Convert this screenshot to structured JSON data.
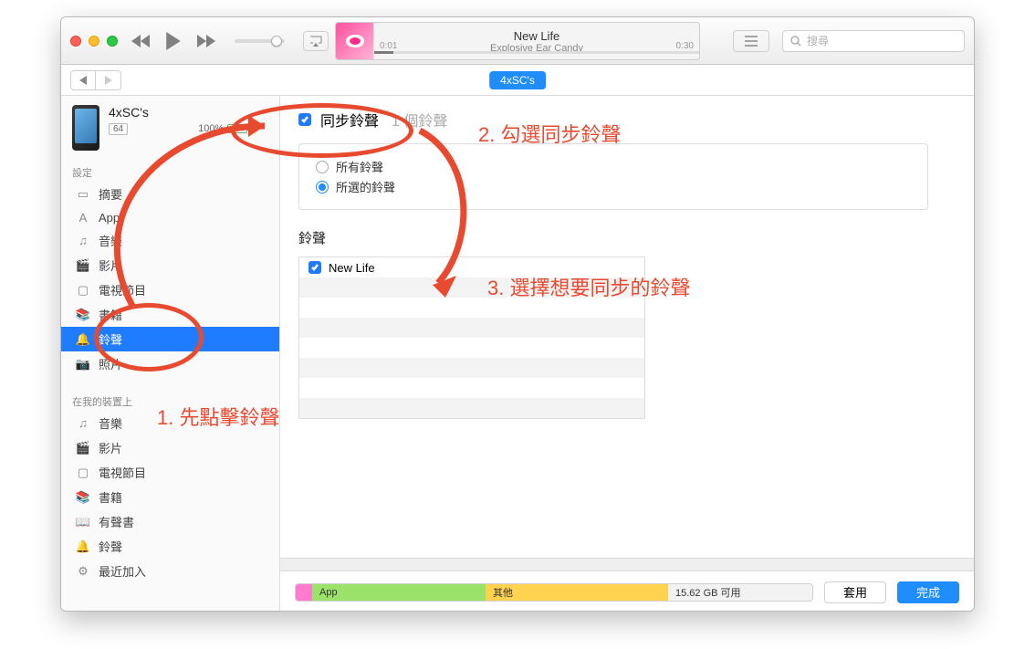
{
  "now_playing": {
    "title": "New Life",
    "artist": "Explosive Ear Candy",
    "elapsed": "0:01",
    "total": "0:30"
  },
  "search": {
    "placeholder": "搜尋"
  },
  "crumb": "4xSC's",
  "device": {
    "name": "4xSC's",
    "capacity": "64",
    "battery": "100%"
  },
  "sections": {
    "settings": "設定",
    "on_device": "在我的裝置上"
  },
  "settings_items": [
    "摘要",
    "App",
    "音樂",
    "影片",
    "電視節目",
    "書籍",
    "鈴聲",
    "照片"
  ],
  "settings_selected_index": 6,
  "device_items": [
    "音樂",
    "影片",
    "電視節目",
    "書籍",
    "有聲書",
    "鈴聲",
    "最近加入"
  ],
  "sync": {
    "checkbox_label": "同步鈴聲",
    "count_label": "1 個鈴聲"
  },
  "radio": {
    "all": "所有鈴聲",
    "selected": "所選的鈴聲"
  },
  "ringtones": {
    "heading": "鈴聲",
    "items": [
      "New Life"
    ]
  },
  "storage": {
    "app": "App",
    "other": "其他",
    "free": "15.62 GB 可用"
  },
  "buttons": {
    "apply": "套用",
    "done": "完成"
  },
  "annotations": {
    "step1": "1. 先點擊鈴聲",
    "step2": "2. 勾選同步鈴聲",
    "step3": "3. 選擇想要同步的鈴聲"
  }
}
